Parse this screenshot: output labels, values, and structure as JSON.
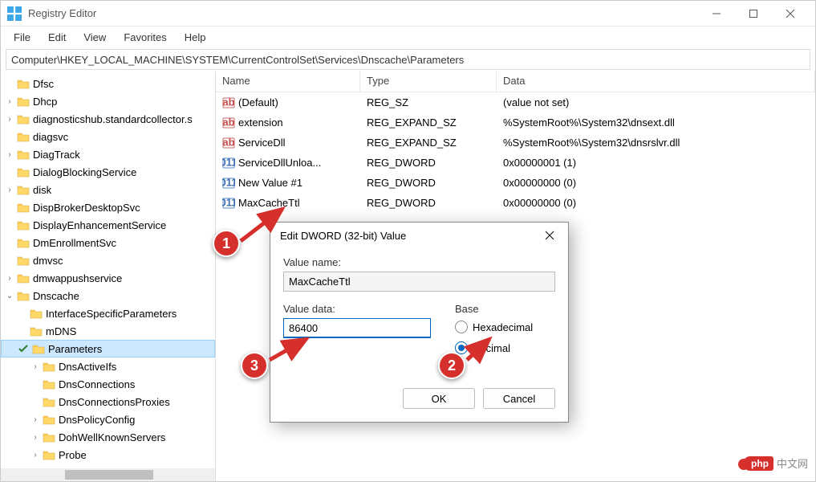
{
  "window": {
    "title": "Registry Editor"
  },
  "menu": {
    "file": "File",
    "edit": "Edit",
    "view": "View",
    "favorites": "Favorites",
    "help": "Help"
  },
  "address": "Computer\\HKEY_LOCAL_MACHINE\\SYSTEM\\CurrentControlSet\\Services\\Dnscache\\Parameters",
  "tree": {
    "items": [
      {
        "label": "Dfsc",
        "indent": 0,
        "chev": ""
      },
      {
        "label": "Dhcp",
        "indent": 0,
        "chev": "›"
      },
      {
        "label": "diagnosticshub.standardcollector.s",
        "indent": 0,
        "chev": "›"
      },
      {
        "label": "diagsvc",
        "indent": 0,
        "chev": ""
      },
      {
        "label": "DiagTrack",
        "indent": 0,
        "chev": "›"
      },
      {
        "label": "DialogBlockingService",
        "indent": 0,
        "chev": ""
      },
      {
        "label": "disk",
        "indent": 0,
        "chev": "›"
      },
      {
        "label": "DispBrokerDesktopSvc",
        "indent": 0,
        "chev": ""
      },
      {
        "label": "DisplayEnhancementService",
        "indent": 0,
        "chev": ""
      },
      {
        "label": "DmEnrollmentSvc",
        "indent": 0,
        "chev": ""
      },
      {
        "label": "dmvsc",
        "indent": 0,
        "chev": ""
      },
      {
        "label": "dmwappushservice",
        "indent": 0,
        "chev": "›"
      },
      {
        "label": "Dnscache",
        "indent": 0,
        "chev": "⌄"
      },
      {
        "label": "InterfaceSpecificParameters",
        "indent": 1,
        "chev": ""
      },
      {
        "label": "mDNS",
        "indent": 1,
        "chev": ""
      },
      {
        "label": "Parameters",
        "indent": 1,
        "chev": "⌄",
        "selected": true
      },
      {
        "label": "DnsActiveIfs",
        "indent": 2,
        "chev": "›"
      },
      {
        "label": "DnsConnections",
        "indent": 2,
        "chev": ""
      },
      {
        "label": "DnsConnectionsProxies",
        "indent": 2,
        "chev": ""
      },
      {
        "label": "DnsPolicyConfig",
        "indent": 2,
        "chev": "›"
      },
      {
        "label": "DohWellKnownServers",
        "indent": 2,
        "chev": "›"
      },
      {
        "label": "Probe",
        "indent": 2,
        "chev": "›"
      }
    ]
  },
  "list": {
    "headers": {
      "name": "Name",
      "type": "Type",
      "data": "Data"
    },
    "rows": [
      {
        "icon": "sz",
        "name": "(Default)",
        "type": "REG_SZ",
        "data": "(value not set)"
      },
      {
        "icon": "sz",
        "name": "extension",
        "type": "REG_EXPAND_SZ",
        "data": "%SystemRoot%\\System32\\dnsext.dll"
      },
      {
        "icon": "sz",
        "name": "ServiceDll",
        "type": "REG_EXPAND_SZ",
        "data": "%SystemRoot%\\System32\\dnsrslvr.dll"
      },
      {
        "icon": "dw",
        "name": "ServiceDllUnloa...",
        "type": "REG_DWORD",
        "data": "0x00000001 (1)"
      },
      {
        "icon": "dw",
        "name": "New Value #1",
        "type": "REG_DWORD",
        "data": "0x00000000 (0)"
      },
      {
        "icon": "dw",
        "name": "MaxCacheTtl",
        "type": "REG_DWORD",
        "data": "0x00000000 (0)"
      }
    ]
  },
  "dialog": {
    "title": "Edit DWORD (32-bit) Value",
    "value_name_label": "Value name:",
    "value_name": "MaxCacheTtl",
    "value_data_label": "Value data:",
    "value_data": "86400",
    "base_label": "Base",
    "hex_label": "Hexadecimal",
    "dec_label": "Decimal",
    "ok": "OK",
    "cancel": "Cancel"
  },
  "annotations": {
    "b1": "1",
    "b2": "2",
    "b3": "3"
  },
  "watermark": {
    "php": "php",
    "cn": "中文网"
  }
}
